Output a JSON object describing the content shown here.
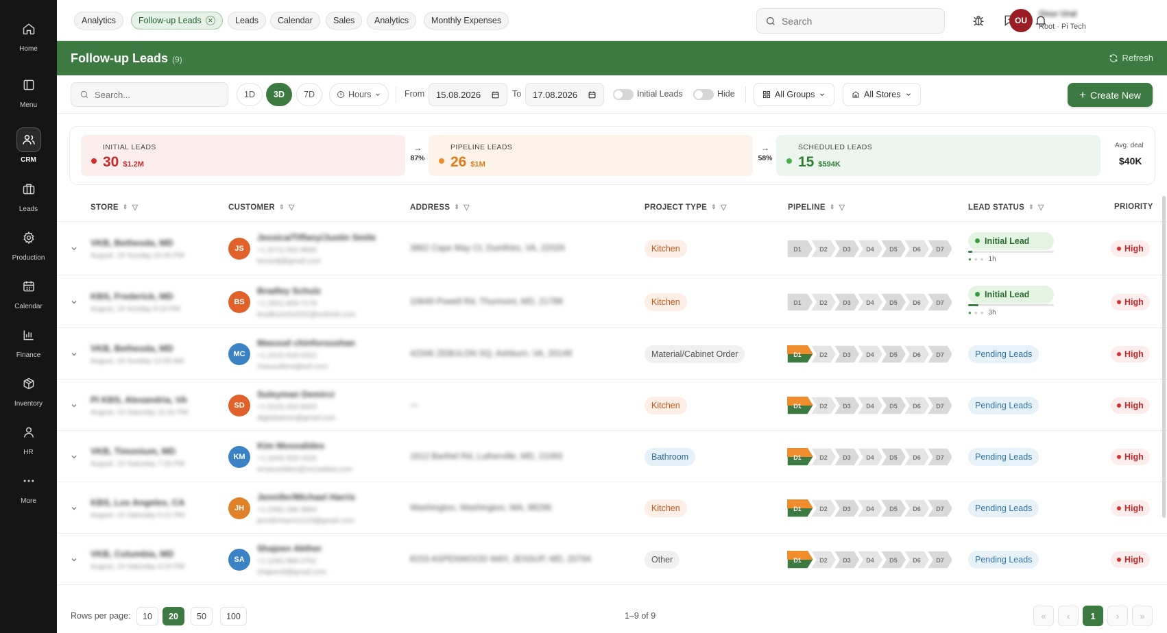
{
  "sidebar": {
    "items": [
      {
        "label": "Home",
        "icon": "home-icon"
      },
      {
        "label": "Menu",
        "icon": "menu-icon"
      },
      {
        "label": "CRM",
        "icon": "users-icon",
        "active": true
      },
      {
        "label": "Leads",
        "icon": "briefcase-icon"
      },
      {
        "label": "Production",
        "icon": "gear-icon"
      },
      {
        "label": "Calendar",
        "icon": "calendar-icon"
      },
      {
        "label": "Finance",
        "icon": "bar-chart-icon"
      },
      {
        "label": "Inventory",
        "icon": "box-icon"
      },
      {
        "label": "HR",
        "icon": "person-icon"
      },
      {
        "label": "More",
        "icon": "more-dots-icon"
      }
    ]
  },
  "tabs": [
    {
      "label": "Analytics"
    },
    {
      "label": "Follow-up Leads",
      "active": true
    },
    {
      "label": "Leads"
    },
    {
      "label": "Calendar"
    },
    {
      "label": "Sales"
    },
    {
      "label": "Analytics"
    },
    {
      "label": "Monthly Expenses"
    }
  ],
  "search": {
    "placeholder": "Search"
  },
  "user": {
    "initials": "OU",
    "name": "Onur Ural",
    "role": "Root · Pi Tech"
  },
  "header": {
    "title": "Follow-up Leads",
    "count": "(9)",
    "refresh_label": "Refresh"
  },
  "filters": {
    "search_placeholder": "Search...",
    "ranges": [
      "1D",
      "3D",
      "7D"
    ],
    "active_range": "3D",
    "unit": "Hours",
    "from_label": "From",
    "from_date": "15.08.2026",
    "to_label": "To",
    "to_date": "17.08.2026",
    "initial_leads_label": "Initial Leads",
    "hide_label": "Hide",
    "groups_label": "All Groups",
    "stores_label": "All Stores",
    "create_label": "Create New"
  },
  "summary": {
    "initial": {
      "label": "INITIAL LEADS",
      "value": "30",
      "amount": "$1.2M"
    },
    "conv1": "87%",
    "pipeline": {
      "label": "PIPELINE LEADS",
      "value": "26",
      "amount": "$1M"
    },
    "conv2": "58%",
    "scheduled": {
      "label": "SCHEDULED LEADS",
      "value": "15",
      "amount": "$594K"
    },
    "avg_label": "Avg. deal",
    "avg_value": "$40K"
  },
  "colors": {
    "accent": "#3c7a41",
    "initial": "#d32f2f",
    "pipeline": "#ef8c2b",
    "scheduled": "#4caf50"
  },
  "columns": [
    "STORE",
    "CUSTOMER",
    "ADDRESS",
    "PROJECT TYPE",
    "PIPELINE",
    "LEAD STATUS",
    "PRIORITY"
  ],
  "pipeline_stages": [
    "D1",
    "D2",
    "D3",
    "D4",
    "D5",
    "D6",
    "D7"
  ],
  "rows": [
    {
      "store": "VKB, Bethesda, MD",
      "date": "August, 16 Sunday 10:45 PM",
      "initials": "JS",
      "avatar_color": "#e0622a",
      "customer": "Jessica/Tiffany/Justin Smile",
      "phone": "+1 (571) 592-8693",
      "email": "kenardj@gmail.com",
      "address": "3862 Cape May Ct, Dumfries, VA, 22026",
      "project_type": "Kitchen",
      "pipeline_started": false,
      "status": "Initial Lead",
      "status_time": "1h",
      "priority": "High"
    },
    {
      "store": "KBS, Frederick, MD",
      "date": "August, 16 Sunday 9:15 PM",
      "initials": "BS",
      "avatar_color": "#e0622a",
      "customer": "Bradley Schulz",
      "phone": "+1 (301) 809-7179",
      "email": "bradleyschul202@outlook.com",
      "address": "10649 Powell Rd, Thurmont, MD, 21788",
      "project_type": "Kitchen",
      "pipeline_started": false,
      "status": "Initial Lead",
      "status_time": "3h",
      "priority": "High"
    },
    {
      "store": "VKB, Bethesda, MD",
      "date": "August, 16 Sunday 12:55 AM",
      "initials": "MC",
      "avatar_color": "#3b82c4",
      "customer": "Masoud chinforoushan",
      "phone": "+1 (312) 618-0322",
      "email": "masoudtera@aol.com",
      "address": "42346 ZEBULON SQ, Ashburn, VA, 20148",
      "project_type": "Material/Cabinet Order",
      "pipeline_started": true,
      "status": "Pending Leads",
      "status_time": "",
      "priority": "High"
    },
    {
      "store": "PI KBS, Alexandria, VA",
      "date": "August, 15 Saturday 11:31 PM",
      "initials": "SD",
      "avatar_color": "#e0622a",
      "customer": "Suleyman Demirci",
      "phone": "+1 (515) 252-8303",
      "email": "digitaladmin@gmail.com",
      "address": "—",
      "project_type": "Kitchen",
      "pipeline_started": true,
      "status": "Pending Leads",
      "status_time": "",
      "priority": "High"
    },
    {
      "store": "VKB, Timonium, MD",
      "date": "August, 15 Saturday 7:26 PM",
      "initials": "KM",
      "avatar_color": "#3b82c4",
      "customer": "Kim Mosxalides",
      "phone": "+1 (443) 928-1916",
      "email": "emanuelides@mcrawlaw.com",
      "address": "1612 Barthel Rd, Lutherville, MD, 21093",
      "project_type": "Bathroom",
      "pipeline_started": true,
      "status": "Pending Leads",
      "status_time": "",
      "priority": "High"
    },
    {
      "store": "KBS, Los Angeles, CA",
      "date": "August, 15 Saturday 5:21 PM",
      "initials": "JH",
      "avatar_color": "#e0822a",
      "customer": "Jennifer/Michael Harris",
      "phone": "+1 (206) 286-3904",
      "email": "jenniferharris1123@gmail.com",
      "address": "Washington, Washington, WA, 98296",
      "project_type": "Kitchen",
      "pipeline_started": true,
      "status": "Pending Leads",
      "status_time": "",
      "priority": "High"
    },
    {
      "store": "VKB, Columbia, MD",
      "date": "August, 15 Saturday 4:24 PM",
      "initials": "SA",
      "avatar_color": "#3b82c4",
      "customer": "Shajeen Akther",
      "phone": "+1 (240) 986-2752",
      "email": "shajeen8@gmail.com",
      "address": "8153 ASPENWOOD WAY, JESSUP, MD, 20794",
      "project_type": "Other",
      "pipeline_started": true,
      "status": "Pending Leads",
      "status_time": "",
      "priority": "High"
    }
  ],
  "footer": {
    "rows_label": "Rows per page:",
    "sizes": [
      "10",
      "20",
      "50",
      "100"
    ],
    "active_size": "20",
    "range": "1–9 of 9",
    "page": "1"
  }
}
